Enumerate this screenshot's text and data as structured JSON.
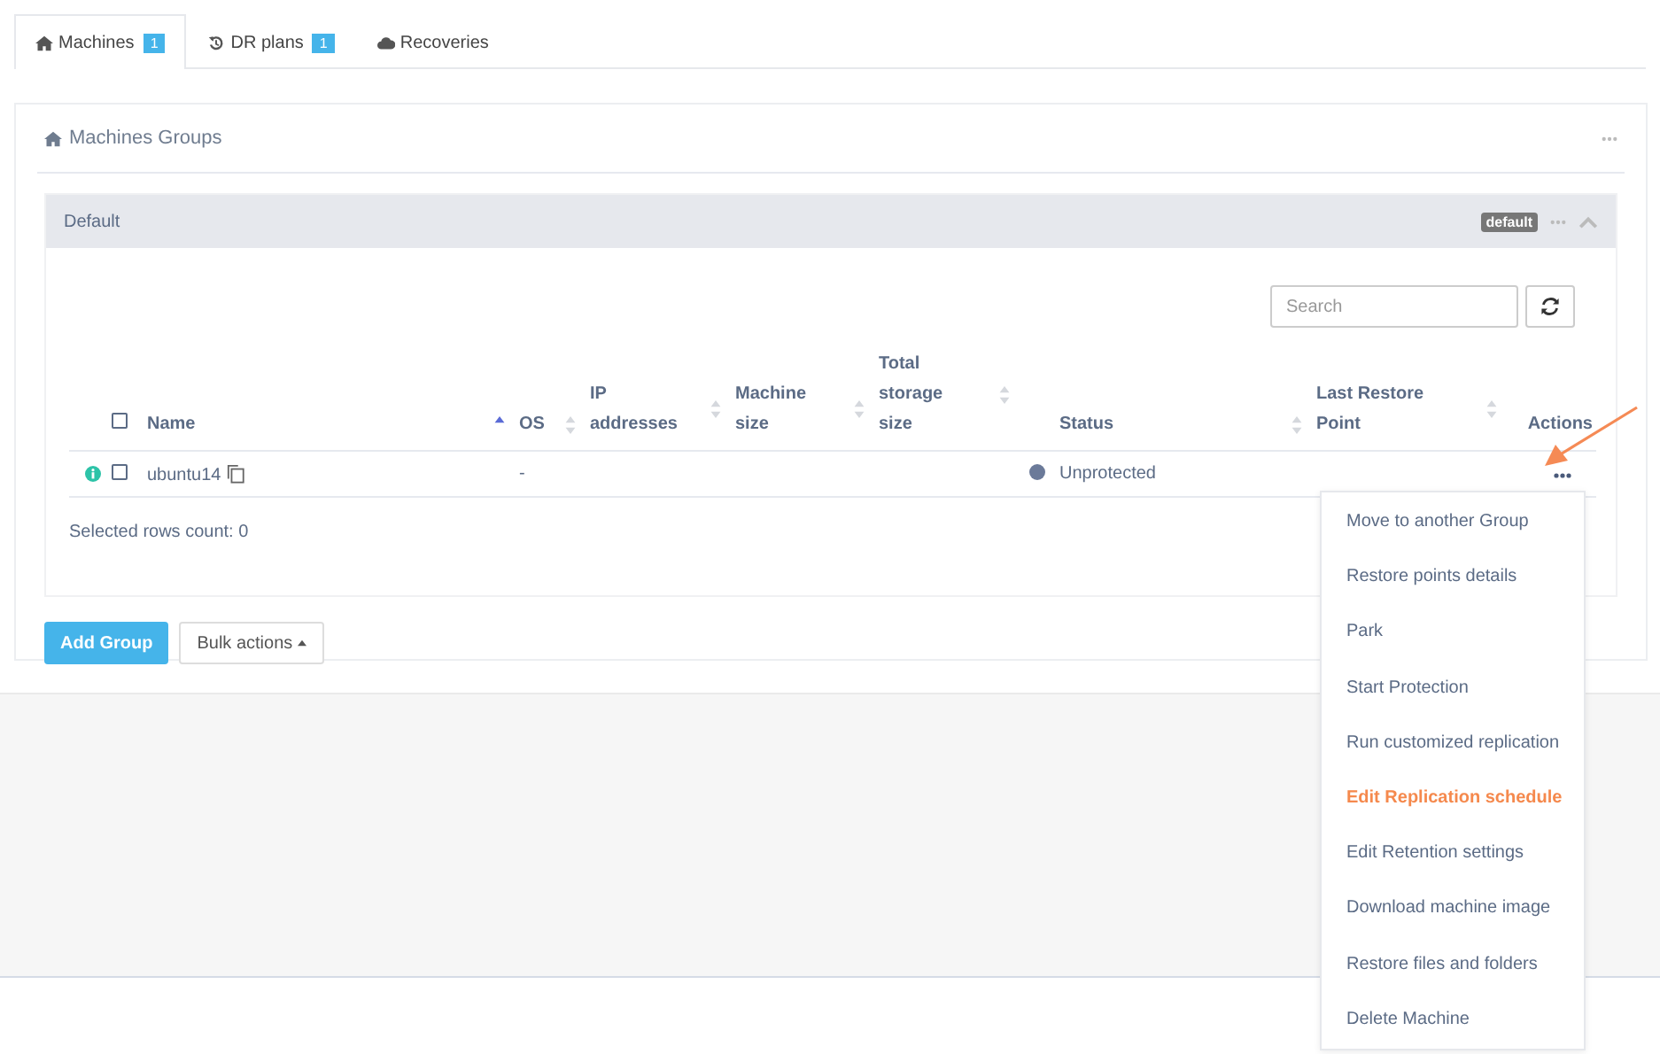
{
  "tabs": [
    {
      "label": "Machines",
      "badge": "1",
      "selected": true
    },
    {
      "label": "DR plans",
      "badge": "1",
      "selected": false
    },
    {
      "label": "Recoveries",
      "selected": false
    }
  ],
  "panel": {
    "title": "Machines Groups"
  },
  "group": {
    "name": "Default",
    "tag": "default",
    "expanded": true
  },
  "search": {
    "placeholder": "Search"
  },
  "table": {
    "columns": [
      {
        "label": "Name",
        "sortable": true,
        "sorted": true
      },
      {
        "label": "OS",
        "sortable": true,
        "sorted": false
      },
      {
        "label": "IP addresses",
        "sortable": true,
        "sorted": false
      },
      {
        "label": "Machine size",
        "sortable": true,
        "sorted": false
      },
      {
        "label": "Total storage size",
        "sortable": true,
        "sorted": false
      },
      {
        "label": "Status",
        "sortable": true,
        "sorted": false
      },
      {
        "label": "Last Restore Point",
        "sortable": true,
        "sorted": false
      },
      {
        "label": "Actions",
        "sortable": false
      }
    ],
    "select_all_checked": false,
    "rows": [
      {
        "name": "ubuntu14",
        "os": "-",
        "ip": "",
        "size": "",
        "storage": "",
        "status": "Unprotected",
        "last_restore": "",
        "checked": false
      }
    ]
  },
  "selected_count": "Selected rows count: 0",
  "buttons": {
    "add": "Add Group",
    "bulk": "Bulk actions"
  },
  "actions_menu": [
    {
      "label": "Move to another Group",
      "selected": false
    },
    {
      "label": "Restore points details",
      "selected": false
    },
    {
      "label": "Park",
      "selected": false
    },
    {
      "label": "Start Protection",
      "selected": false
    },
    {
      "label": "Run customized replication",
      "selected": false
    },
    {
      "label": "Edit Replication schedule",
      "selected": true
    },
    {
      "label": "Edit Retention settings",
      "selected": false
    },
    {
      "label": "Download machine image",
      "selected": false
    },
    {
      "label": "Restore files and folders",
      "selected": false
    },
    {
      "label": "Delete Machine",
      "selected": false
    }
  ]
}
